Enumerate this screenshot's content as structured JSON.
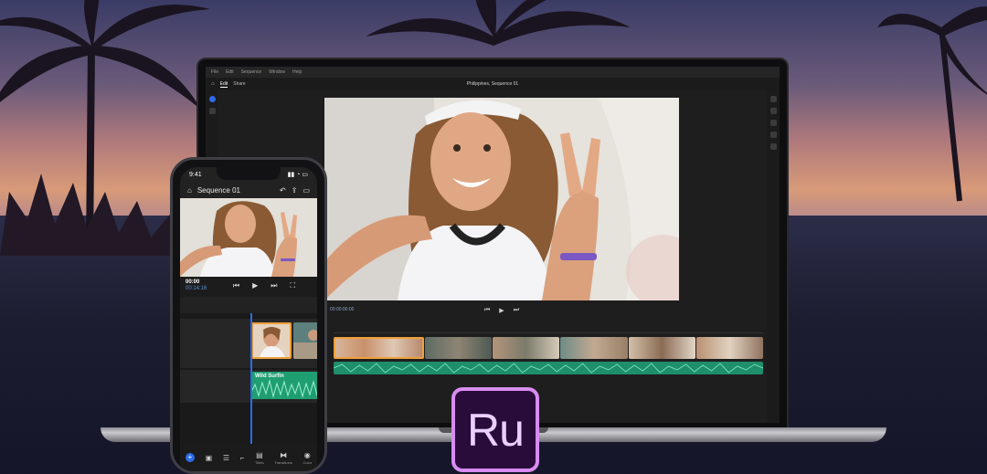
{
  "laptop": {
    "menu": [
      "File",
      "Edit",
      "Sequence",
      "Window",
      "Help"
    ],
    "tabs": [
      "Edit",
      "Share"
    ],
    "sequence_title": "Philippines, Sequence 01",
    "timecode": "00:00:00:00"
  },
  "phone": {
    "time": "9:41",
    "sequence_title": "Sequence 01",
    "timecode": "00:00",
    "duration": "00:14:16",
    "audio_clip_label": "Wild Surfin",
    "toolbar": [
      "Titles",
      "Transitions",
      "Color"
    ]
  },
  "brand": {
    "logo_text": "Ru",
    "accent": "#d88cf0",
    "highlight": "#f0a03a",
    "audio_color": "#1f9e72",
    "ui_blue": "#2d6be8"
  }
}
